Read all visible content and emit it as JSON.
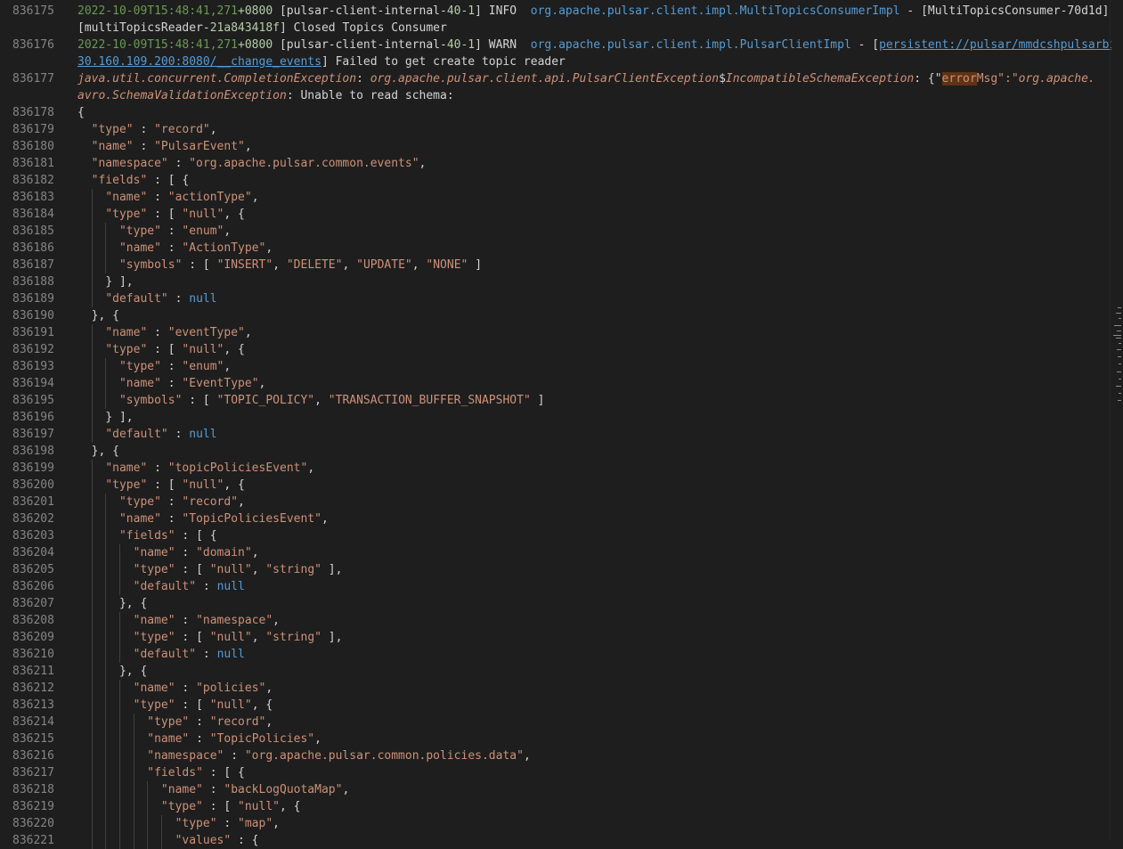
{
  "log": {
    "line836175": {
      "num": "836175",
      "ts": "2022-10-09T15:48:41,271",
      "tz_plus": "+",
      "tz": "0800",
      "thread_open": " [pulsar-client-internal-",
      "thread_num": "40-1",
      "thread_close": "] INFO  ",
      "cls": "org.apache.pulsar.client.impl.MultiTopicsConsumerImpl",
      "dash": " - [MultiTopicsConsumer-70d1d]",
      "cont_a": "[multiTopicsReader-",
      "cont_id": "21a843418f",
      "cont_b": "] Closed Topics Consumer"
    },
    "line836176": {
      "num": "836176",
      "ts": "2022-10-09T15:48:41,271",
      "tz_plus": "+",
      "tz": "0800",
      "thread_open": " [pulsar-client-internal-",
      "thread_num": "40-1",
      "thread_close": "] WARN  ",
      "cls": "org.apache.pulsar.client.impl.PulsarClientImpl",
      "dash": " - [",
      "url1": "persistent://pulsar/mmdcshpulsarbi/",
      "url2": "30.160.109.200:8080/__change_events",
      "tail": "] Failed to get create topic reader"
    },
    "line836177": {
      "num": "836177",
      "exc1": "java.util.concurrent.CompletionException",
      "sep1": ": ",
      "exc2": "org.apache.pulsar.client.api.PulsarClientException",
      "dollar": "$",
      "exc3": "IncompatibleSchemaException",
      "sep2": ": {\"",
      "hl": "error",
      "rest1": "Msg\":\"",
      "exc4": "org.apache.",
      "exc5": "avro.SchemaValidationException",
      "rest2": ": Unable to read schema:"
    }
  },
  "json_lines": [
    {
      "n": "836178",
      "i": 0,
      "p": [
        [
          "p",
          "{"
        ]
      ]
    },
    {
      "n": "836179",
      "i": 1,
      "p": [
        [
          "k",
          "\"type\""
        ],
        [
          "p",
          " : "
        ],
        [
          "s",
          "\"record\""
        ],
        [
          "p",
          ","
        ]
      ]
    },
    {
      "n": "836180",
      "i": 1,
      "p": [
        [
          "k",
          "\"name\""
        ],
        [
          "p",
          " : "
        ],
        [
          "s",
          "\"PulsarEvent\""
        ],
        [
          "p",
          ","
        ]
      ]
    },
    {
      "n": "836181",
      "i": 1,
      "p": [
        [
          "k",
          "\"namespace\""
        ],
        [
          "p",
          " : "
        ],
        [
          "s",
          "\"org.apache.pulsar.common.events\""
        ],
        [
          "p",
          ","
        ]
      ]
    },
    {
      "n": "836182",
      "i": 1,
      "p": [
        [
          "k",
          "\"fields\""
        ],
        [
          "p",
          " : [ {"
        ]
      ]
    },
    {
      "n": "836183",
      "i": 2,
      "p": [
        [
          "k",
          "\"name\""
        ],
        [
          "p",
          " : "
        ],
        [
          "s",
          "\"actionType\""
        ],
        [
          "p",
          ","
        ]
      ]
    },
    {
      "n": "836184",
      "i": 2,
      "p": [
        [
          "k",
          "\"type\""
        ],
        [
          "p",
          " : [ "
        ],
        [
          "s",
          "\"null\""
        ],
        [
          "p",
          ", {"
        ]
      ]
    },
    {
      "n": "836185",
      "i": 3,
      "p": [
        [
          "k",
          "\"type\""
        ],
        [
          "p",
          " : "
        ],
        [
          "s",
          "\"enum\""
        ],
        [
          "p",
          ","
        ]
      ]
    },
    {
      "n": "836186",
      "i": 3,
      "p": [
        [
          "k",
          "\"name\""
        ],
        [
          "p",
          " : "
        ],
        [
          "s",
          "\"ActionType\""
        ],
        [
          "p",
          ","
        ]
      ]
    },
    {
      "n": "836187",
      "i": 3,
      "p": [
        [
          "k",
          "\"symbols\""
        ],
        [
          "p",
          " : [ "
        ],
        [
          "s",
          "\"INSERT\""
        ],
        [
          "p",
          ", "
        ],
        [
          "s",
          "\"DELETE\""
        ],
        [
          "p",
          ", "
        ],
        [
          "s",
          "\"UPDATE\""
        ],
        [
          "p",
          ", "
        ],
        [
          "s",
          "\"NONE\""
        ],
        [
          "p",
          " ]"
        ]
      ]
    },
    {
      "n": "836188",
      "i": 2,
      "p": [
        [
          "p",
          "} ],"
        ]
      ]
    },
    {
      "n": "836189",
      "i": 2,
      "p": [
        [
          "k",
          "\"default\""
        ],
        [
          "p",
          " : "
        ],
        [
          "n",
          "null"
        ]
      ]
    },
    {
      "n": "836190",
      "i": 1,
      "p": [
        [
          "p",
          "}, {"
        ]
      ]
    },
    {
      "n": "836191",
      "i": 2,
      "p": [
        [
          "k",
          "\"name\""
        ],
        [
          "p",
          " : "
        ],
        [
          "s",
          "\"eventType\""
        ],
        [
          "p",
          ","
        ]
      ]
    },
    {
      "n": "836192",
      "i": 2,
      "p": [
        [
          "k",
          "\"type\""
        ],
        [
          "p",
          " : [ "
        ],
        [
          "s",
          "\"null\""
        ],
        [
          "p",
          ", {"
        ]
      ]
    },
    {
      "n": "836193",
      "i": 3,
      "p": [
        [
          "k",
          "\"type\""
        ],
        [
          "p",
          " : "
        ],
        [
          "s",
          "\"enum\""
        ],
        [
          "p",
          ","
        ]
      ]
    },
    {
      "n": "836194",
      "i": 3,
      "p": [
        [
          "k",
          "\"name\""
        ],
        [
          "p",
          " : "
        ],
        [
          "s",
          "\"EventType\""
        ],
        [
          "p",
          ","
        ]
      ]
    },
    {
      "n": "836195",
      "i": 3,
      "p": [
        [
          "k",
          "\"symbols\""
        ],
        [
          "p",
          " : [ "
        ],
        [
          "s",
          "\"TOPIC_POLICY\""
        ],
        [
          "p",
          ", "
        ],
        [
          "s",
          "\"TRANSACTION_BUFFER_SNAPSHOT\""
        ],
        [
          "p",
          " ]"
        ]
      ]
    },
    {
      "n": "836196",
      "i": 2,
      "p": [
        [
          "p",
          "} ],"
        ]
      ]
    },
    {
      "n": "836197",
      "i": 2,
      "p": [
        [
          "k",
          "\"default\""
        ],
        [
          "p",
          " : "
        ],
        [
          "n",
          "null"
        ]
      ]
    },
    {
      "n": "836198",
      "i": 1,
      "p": [
        [
          "p",
          "}, {"
        ]
      ]
    },
    {
      "n": "836199",
      "i": 2,
      "p": [
        [
          "k",
          "\"name\""
        ],
        [
          "p",
          " : "
        ],
        [
          "s",
          "\"topicPoliciesEvent\""
        ],
        [
          "p",
          ","
        ]
      ]
    },
    {
      "n": "836200",
      "i": 2,
      "p": [
        [
          "k",
          "\"type\""
        ],
        [
          "p",
          " : [ "
        ],
        [
          "s",
          "\"null\""
        ],
        [
          "p",
          ", {"
        ]
      ]
    },
    {
      "n": "836201",
      "i": 3,
      "p": [
        [
          "k",
          "\"type\""
        ],
        [
          "p",
          " : "
        ],
        [
          "s",
          "\"record\""
        ],
        [
          "p",
          ","
        ]
      ]
    },
    {
      "n": "836202",
      "i": 3,
      "p": [
        [
          "k",
          "\"name\""
        ],
        [
          "p",
          " : "
        ],
        [
          "s",
          "\"TopicPoliciesEvent\""
        ],
        [
          "p",
          ","
        ]
      ]
    },
    {
      "n": "836203",
      "i": 3,
      "p": [
        [
          "k",
          "\"fields\""
        ],
        [
          "p",
          " : [ {"
        ]
      ]
    },
    {
      "n": "836204",
      "i": 4,
      "p": [
        [
          "k",
          "\"name\""
        ],
        [
          "p",
          " : "
        ],
        [
          "s",
          "\"domain\""
        ],
        [
          "p",
          ","
        ]
      ]
    },
    {
      "n": "836205",
      "i": 4,
      "p": [
        [
          "k",
          "\"type\""
        ],
        [
          "p",
          " : [ "
        ],
        [
          "s",
          "\"null\""
        ],
        [
          "p",
          ", "
        ],
        [
          "s",
          "\"string\""
        ],
        [
          "p",
          " ],"
        ]
      ]
    },
    {
      "n": "836206",
      "i": 4,
      "p": [
        [
          "k",
          "\"default\""
        ],
        [
          "p",
          " : "
        ],
        [
          "n",
          "null"
        ]
      ]
    },
    {
      "n": "836207",
      "i": 3,
      "p": [
        [
          "p",
          "}, {"
        ]
      ]
    },
    {
      "n": "836208",
      "i": 4,
      "p": [
        [
          "k",
          "\"name\""
        ],
        [
          "p",
          " : "
        ],
        [
          "s",
          "\"namespace\""
        ],
        [
          "p",
          ","
        ]
      ]
    },
    {
      "n": "836209",
      "i": 4,
      "p": [
        [
          "k",
          "\"type\""
        ],
        [
          "p",
          " : [ "
        ],
        [
          "s",
          "\"null\""
        ],
        [
          "p",
          ", "
        ],
        [
          "s",
          "\"string\""
        ],
        [
          "p",
          " ],"
        ]
      ]
    },
    {
      "n": "836210",
      "i": 4,
      "p": [
        [
          "k",
          "\"default\""
        ],
        [
          "p",
          " : "
        ],
        [
          "n",
          "null"
        ]
      ]
    },
    {
      "n": "836211",
      "i": 3,
      "p": [
        [
          "p",
          "}, {"
        ]
      ]
    },
    {
      "n": "836212",
      "i": 4,
      "p": [
        [
          "k",
          "\"name\""
        ],
        [
          "p",
          " : "
        ],
        [
          "s",
          "\"policies\""
        ],
        [
          "p",
          ","
        ]
      ]
    },
    {
      "n": "836213",
      "i": 4,
      "p": [
        [
          "k",
          "\"type\""
        ],
        [
          "p",
          " : [ "
        ],
        [
          "s",
          "\"null\""
        ],
        [
          "p",
          ", {"
        ]
      ]
    },
    {
      "n": "836214",
      "i": 5,
      "p": [
        [
          "k",
          "\"type\""
        ],
        [
          "p",
          " : "
        ],
        [
          "s",
          "\"record\""
        ],
        [
          "p",
          ","
        ]
      ]
    },
    {
      "n": "836215",
      "i": 5,
      "p": [
        [
          "k",
          "\"name\""
        ],
        [
          "p",
          " : "
        ],
        [
          "s",
          "\"TopicPolicies\""
        ],
        [
          "p",
          ","
        ]
      ]
    },
    {
      "n": "836216",
      "i": 5,
      "p": [
        [
          "k",
          "\"namespace\""
        ],
        [
          "p",
          " : "
        ],
        [
          "s",
          "\"org.apache.pulsar.common.policies.data\""
        ],
        [
          "p",
          ","
        ]
      ]
    },
    {
      "n": "836217",
      "i": 5,
      "p": [
        [
          "k",
          "\"fields\""
        ],
        [
          "p",
          " : [ {"
        ]
      ]
    },
    {
      "n": "836218",
      "i": 6,
      "p": [
        [
          "k",
          "\"name\""
        ],
        [
          "p",
          " : "
        ],
        [
          "s",
          "\"backLogQuotaMap\""
        ],
        [
          "p",
          ","
        ]
      ]
    },
    {
      "n": "836219",
      "i": 6,
      "p": [
        [
          "k",
          "\"type\""
        ],
        [
          "p",
          " : [ "
        ],
        [
          "s",
          "\"null\""
        ],
        [
          "p",
          ", {"
        ]
      ]
    },
    {
      "n": "836220",
      "i": 7,
      "p": [
        [
          "k",
          "\"type\""
        ],
        [
          "p",
          " : "
        ],
        [
          "s",
          "\"map\""
        ],
        [
          "p",
          ","
        ]
      ]
    },
    {
      "n": "836221",
      "i": 7,
      "p": [
        [
          "k",
          "\"values\""
        ],
        [
          "p",
          " : {"
        ]
      ]
    }
  ],
  "colors": {
    "background": "#1e1e1e",
    "line_number": "#858585",
    "timestamp": "#6a9955",
    "class_ref": "#569cd6",
    "string": "#ce9178",
    "null_literal": "#569cd6",
    "highlight": "#613214"
  }
}
